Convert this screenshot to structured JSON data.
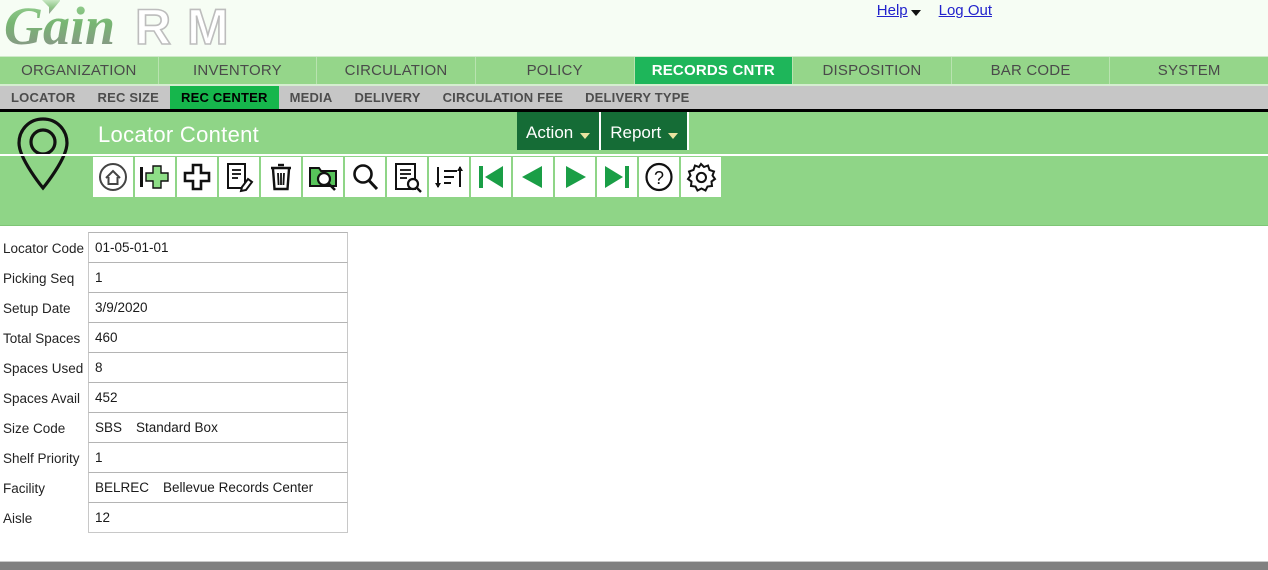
{
  "brand": {
    "name_part1": "Gain",
    "name_part2": "RM"
  },
  "top_links": {
    "help": "Help",
    "log_out": "Log Out"
  },
  "main_nav": {
    "items": [
      {
        "label": "ORGANIZATION",
        "active": false
      },
      {
        "label": "INVENTORY",
        "active": false
      },
      {
        "label": "CIRCULATION",
        "active": false
      },
      {
        "label": "POLICY",
        "active": false
      },
      {
        "label": "RECORDS CNTR",
        "active": true
      },
      {
        "label": "DISPOSITION",
        "active": false
      },
      {
        "label": "BAR CODE",
        "active": false
      },
      {
        "label": "SYSTEM",
        "active": false
      }
    ]
  },
  "sub_nav": {
    "items": [
      {
        "label": "LOCATOR",
        "active": false
      },
      {
        "label": "REC SIZE",
        "active": false
      },
      {
        "label": "REC CENTER",
        "active": true
      },
      {
        "label": "MEDIA",
        "active": false
      },
      {
        "label": "DELIVERY",
        "active": false
      },
      {
        "label": "CIRCULATION FEE",
        "active": false
      },
      {
        "label": "DELIVERY TYPE",
        "active": false
      }
    ]
  },
  "page": {
    "title": "Locator Content"
  },
  "menu_buttons": {
    "action": "Action",
    "report": "Report"
  },
  "toolbar": {
    "icons": [
      "home-icon",
      "add-green-icon",
      "plus-icon",
      "edit-document-icon",
      "delete-trash-icon",
      "folder-search-icon",
      "search-magnifier-icon",
      "document-search-icon",
      "sort-icon",
      "first-record-icon",
      "previous-record-icon",
      "next-record-icon",
      "last-record-icon",
      "help-circle-icon",
      "settings-gear-icon"
    ]
  },
  "form": {
    "fields": [
      {
        "label": "Locator Code",
        "value": "01-05-01-01",
        "value2": ""
      },
      {
        "label": "Picking Seq",
        "value": "1",
        "value2": ""
      },
      {
        "label": "Setup Date",
        "value": "3/9/2020",
        "value2": ""
      },
      {
        "label": "Total Spaces",
        "value": "460",
        "value2": ""
      },
      {
        "label": "Spaces Used",
        "value": "8",
        "value2": ""
      },
      {
        "label": "Spaces Avail",
        "value": "452",
        "value2": ""
      },
      {
        "label": "Size Code",
        "value": "SBS",
        "value2": "Standard Box"
      },
      {
        "label": "Shelf Priority",
        "value": "1",
        "value2": ""
      },
      {
        "label": "Facility",
        "value": "BELREC",
        "value2": "Bellevue Records Center"
      },
      {
        "label": "Aisle",
        "value": "12",
        "value2": ""
      }
    ]
  },
  "colors": {
    "nav_green": "#95d68a",
    "active_tab_green": "#1eb65a",
    "header_green": "#8fd587",
    "menu_button_green": "#156c36",
    "subnav_gray": "#c6c6c6",
    "subnav_active_green": "#16b64c",
    "link_blue": "#2222cc",
    "footer_gray": "#808080"
  }
}
